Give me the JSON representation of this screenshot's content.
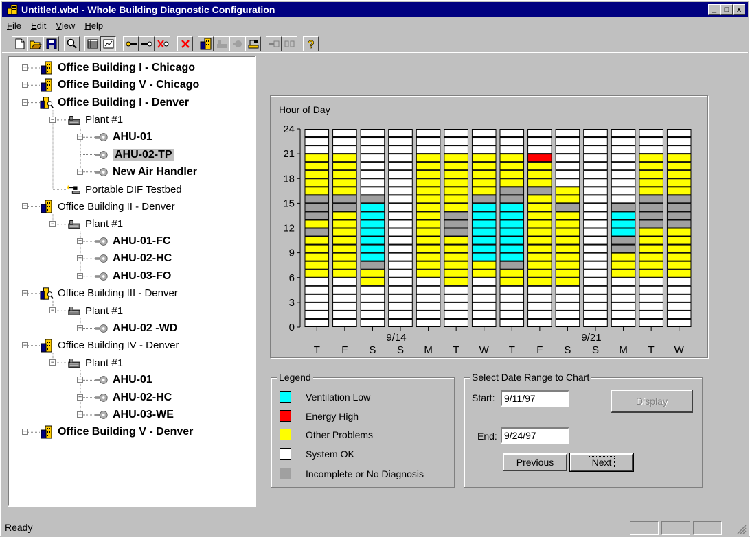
{
  "window": {
    "title": "Untitled.wbd - Whole Building Diagnostic Configuration",
    "min": "_",
    "max": "□",
    "close": "x"
  },
  "menu": [
    "File",
    "Edit",
    "View",
    "Help"
  ],
  "toolbar": [
    "new-icon",
    "open-icon",
    "save-icon",
    "find-icon",
    "table-view-icon",
    "chart-view-icon",
    "link-icon",
    "link-add-icon",
    "link-delete-icon",
    "delete-icon",
    "building-icon",
    "plant-icon",
    "ahu-icon",
    "testbed-icon",
    "connect-icon",
    "disconnect-icon",
    "help-icon"
  ],
  "tree": [
    {
      "label": "Office Building I - Chicago",
      "bold": true,
      "icon": "building-icon",
      "expander": "+"
    },
    {
      "label": "Office Building V - Chicago",
      "bold": true,
      "icon": "building-icon",
      "expander": "+"
    },
    {
      "label": "Office Building I - Denver",
      "bold": true,
      "icon": "building-search-icon",
      "expander": "−"
    },
    {
      "label": "Plant #1",
      "bold": false,
      "icon": "plant-icon",
      "expander": "−"
    },
    {
      "label": "AHU-01",
      "bold": true,
      "icon": "ahu-icon",
      "expander": "+"
    },
    {
      "label": "AHU-02-TP",
      "bold": true,
      "icon": "ahu-icon",
      "expander": "",
      "selected": true
    },
    {
      "label": "New Air Handler",
      "bold": true,
      "icon": "ahu-icon",
      "expander": "+"
    },
    {
      "label": "Portable DIF Testbed",
      "bold": false,
      "icon": "testbed-icon",
      "expander": ""
    },
    {
      "label": "Office Building II - Denver",
      "bold": false,
      "icon": "building-icon",
      "expander": "−"
    },
    {
      "label": "Plant #1",
      "bold": false,
      "icon": "plant-icon",
      "expander": "−"
    },
    {
      "label": "AHU-01-FC",
      "bold": true,
      "icon": "ahu-icon",
      "expander": "+"
    },
    {
      "label": "AHU-02-HC",
      "bold": true,
      "icon": "ahu-icon",
      "expander": "+"
    },
    {
      "label": "AHU-03-FO",
      "bold": true,
      "icon": "ahu-icon",
      "expander": "+"
    },
    {
      "label": "Office Building III - Denver",
      "bold": false,
      "icon": "building-search-icon",
      "expander": "−"
    },
    {
      "label": "Plant #1",
      "bold": false,
      "icon": "plant-icon",
      "expander": "−"
    },
    {
      "label": "AHU-02 -WD",
      "bold": true,
      "icon": "ahu-icon",
      "expander": "+"
    },
    {
      "label": "Office Building IV - Denver",
      "bold": false,
      "icon": "building-icon",
      "expander": "−"
    },
    {
      "label": "Plant #1",
      "bold": false,
      "icon": "plant-icon",
      "expander": "−"
    },
    {
      "label": "AHU-01",
      "bold": true,
      "icon": "ahu-icon",
      "expander": "+"
    },
    {
      "label": "AHU-02-HC",
      "bold": true,
      "icon": "ahu-icon",
      "expander": "+"
    },
    {
      "label": "AHU-03-WE",
      "bold": true,
      "icon": "ahu-icon",
      "expander": "+"
    },
    {
      "label": "Office Building V - Denver",
      "bold": true,
      "icon": "building-icon",
      "expander": "+"
    }
  ],
  "chart_data": {
    "type": "heatmap",
    "ylabel": "Hour of Day",
    "ylim": [
      0,
      24
    ],
    "yticks": [
      0,
      3,
      6,
      9,
      12,
      15,
      18,
      21,
      24
    ],
    "categories": [
      "T",
      "F",
      "S",
      "S",
      "M",
      "T",
      "W",
      "T",
      "F",
      "S",
      "S",
      "M",
      "T",
      "W"
    ],
    "date_labels": [
      {
        "index": 3,
        "text": "9/14"
      },
      {
        "index": 10,
        "text": "9/21"
      }
    ],
    "status_codes": {
      "O": "System OK",
      "V": "Ventilation Low",
      "E": "Energy High",
      "P": "Other Problems",
      "I": "Incomplete or No Diagnosis"
    },
    "colors": {
      "O": "#ffffff",
      "V": "#00ffff",
      "E": "#ff0000",
      "P": "#ffff00",
      "I": "#a0a0a0"
    },
    "hours_bottom_to_top": [
      "OOOOOOPPPPPIPIIIPPPPPOOO",
      "OOOOOOPPPPPPPPIIPPPPPOOO",
      "OOOOOPPIVVVVVVVIOOOOOOOO",
      "OOOOOOOOOOOOOOOOOOOOOOOO",
      "OOOOOOPPPPPPPPPPPPPPPOOO",
      "OOOOOPPPPPPIIIPPPPPPPOOO",
      "OOOOOOPPVVVVVVVIPPPPPOOO",
      "OOOOOPPIVVVVVVVIIPPPPOOO",
      "OOOOOPPPPPPPPPPPIPPPEOOO",
      "OOOOOPPPPPPPPPIPPOOOOOOO",
      "OOOOOOOOOOOOOOOOOOOOOOOO",
      "OOOOOOPPPIIVVVIOOOOOOOOO",
      "OOOOOOPPPPPPIIIIPPPPPOOO",
      "OOOOOOPPPPPPIIIIPPPPPOOO"
    ]
  },
  "legend": {
    "title": "Legend",
    "items": [
      {
        "label": "Ventilation Low",
        "color": "#00ffff"
      },
      {
        "label": "Energy High",
        "color": "#ff0000"
      },
      {
        "label": "Other Problems",
        "color": "#ffff00"
      },
      {
        "label": "System OK",
        "color": "#ffffff"
      },
      {
        "label": "Incomplete or No Diagnosis",
        "color": "#a0a0a0"
      }
    ]
  },
  "date_range": {
    "title": "Select Date Range to Chart",
    "start_label": "Start:",
    "start_value": "9/11/97",
    "end_label": "End:",
    "end_value": "9/24/97",
    "display": "Display",
    "previous": "Previous",
    "next": "Next"
  },
  "status": {
    "text": "Ready"
  }
}
